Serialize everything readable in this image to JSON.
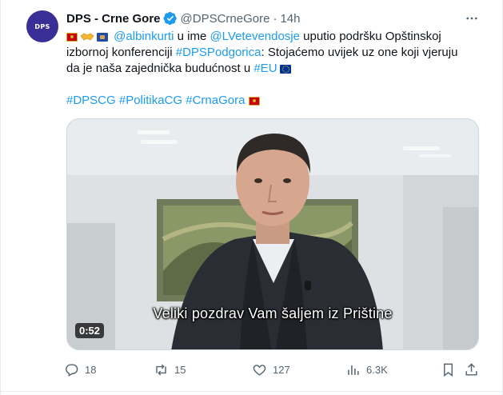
{
  "tweet": {
    "avatar_text": "DPS",
    "author_name": "DPS - Crne Gore",
    "handle": "@DPSCrneGore",
    "separator": "·",
    "time": "14h",
    "line1": {
      "mention1": "@albinkurti",
      "text1": " u ime ",
      "mention2": "@LVetevendosje",
      "text2": " uputio podršku Opštinskoj"
    },
    "line2": {
      "text1": "izbornoj konferenciji ",
      "hashtag": "#DPSPodgorica",
      "text2": ": Stojaćemo uvijek uz one koji vjeruju"
    },
    "line3": {
      "text1": "da je naša zajednička budućnost u ",
      "hashtag": "#EU"
    },
    "hashtags": [
      "#DPSCG",
      "#PolitikaCG",
      "#CrnaGora"
    ]
  },
  "video": {
    "duration": "0:52",
    "subtitle": "Veliki pozdrav Vam šaljem iz Prištine"
  },
  "actions": {
    "replies": "18",
    "reposts": "15",
    "likes": "127",
    "views": "6.3K"
  },
  "colors": {
    "accent": "#1d9bf0",
    "muted": "#536471",
    "text": "#0f1419",
    "avatar_bg": "#3a2f96"
  }
}
